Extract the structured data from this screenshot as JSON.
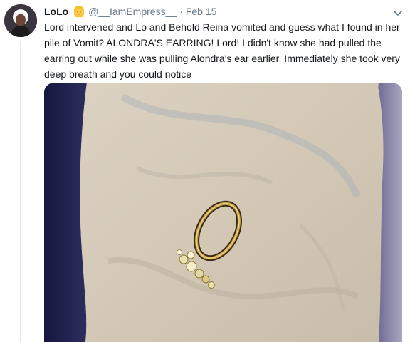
{
  "tweet": {
    "display_name": "LoLo",
    "emoji_icon": "person-blond-hair-emoji",
    "handle": "@__IamEmpress__",
    "separator": "·",
    "date": "Feb 15",
    "text": "Lord intervened and Lo and Behold Reina vomited and guess what I found in her pile of Vomit? ALONDRA'S EARRING! Lord! I didn't know she had pulled the earring out while she was pulling Alondra's ear earlier. Immediately she took very deep breath and you could notice",
    "menu_icon": "chevron-down-icon",
    "media": {
      "type": "photo",
      "subject": "gold hoop earring with crystals on white fabric"
    }
  },
  "colors": {
    "text_primary": "#14171a",
    "text_secondary": "#657786",
    "thread_line": "#e1e8ed"
  }
}
